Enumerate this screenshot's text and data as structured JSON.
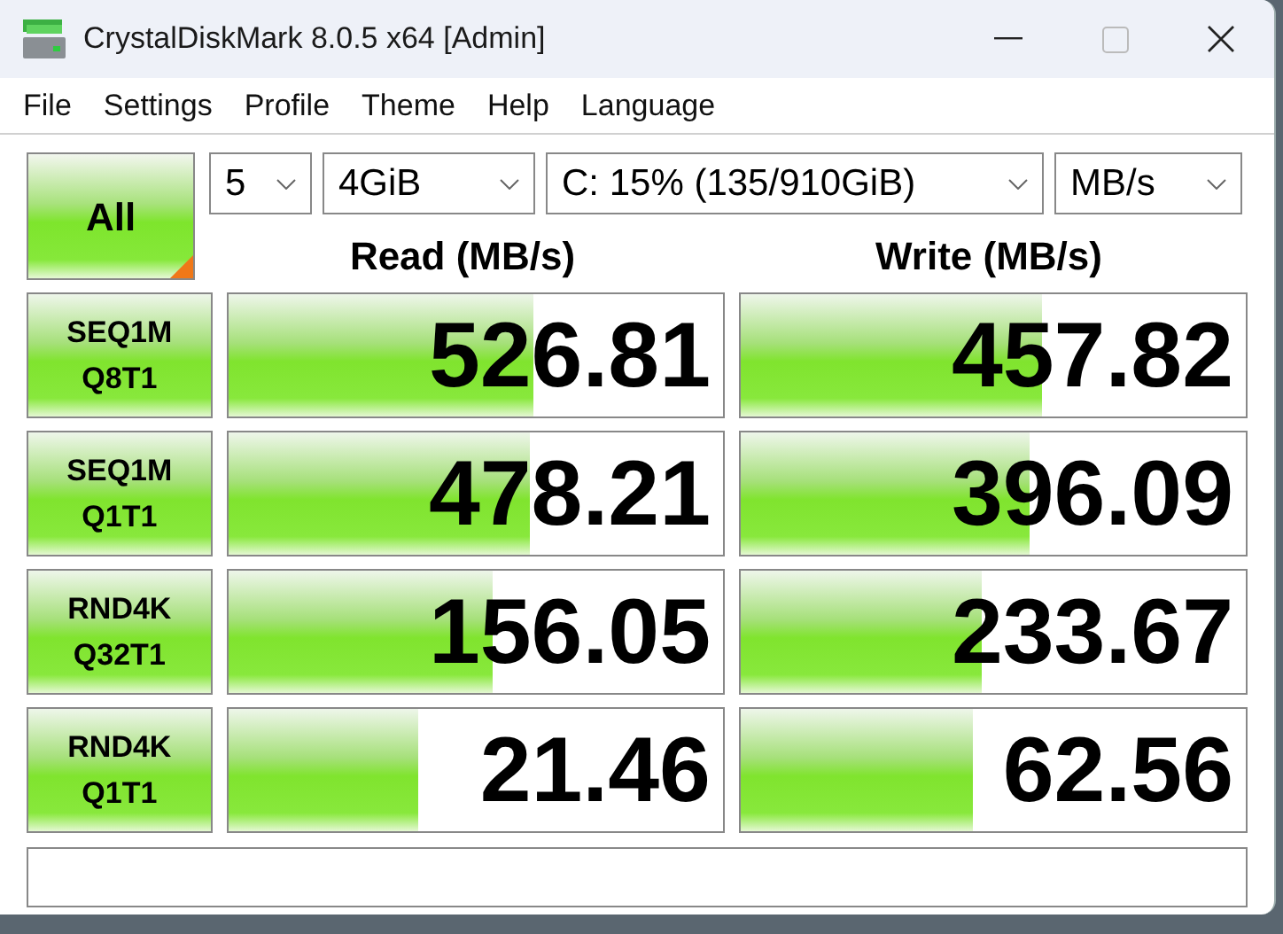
{
  "window": {
    "title": "CrystalDiskMark 8.0.5 x64 [Admin]"
  },
  "menu": [
    "File",
    "Settings",
    "Profile",
    "Theme",
    "Help",
    "Language"
  ],
  "all_button": {
    "label": "All"
  },
  "selectors": [
    {
      "value": "5"
    },
    {
      "value": "4GiB"
    },
    {
      "value": "C: 15% (135/910GiB)"
    },
    {
      "value": "MB/s"
    }
  ],
  "columns": [
    "Read (MB/s)",
    "Write (MB/s)"
  ],
  "tests": [
    {
      "line1": "SEQ1M",
      "line2": "Q8T1",
      "read": {
        "value": "526.81",
        "level": 0.615
      },
      "write": {
        "value": "457.82",
        "level": 0.595
      }
    },
    {
      "line1": "SEQ1M",
      "line2": "Q1T1",
      "read": {
        "value": "478.21",
        "level": 0.608
      },
      "write": {
        "value": "396.09",
        "level": 0.572
      }
    },
    {
      "line1": "RND4K",
      "line2": "Q32T1",
      "read": {
        "value": "156.05",
        "level": 0.533
      },
      "write": {
        "value": "233.67",
        "level": 0.478
      }
    },
    {
      "line1": "RND4K",
      "line2": "Q1T1",
      "read": {
        "value": "21.46",
        "level": 0.385
      },
      "write": {
        "value": "62.56",
        "level": 0.46
      }
    }
  ]
}
